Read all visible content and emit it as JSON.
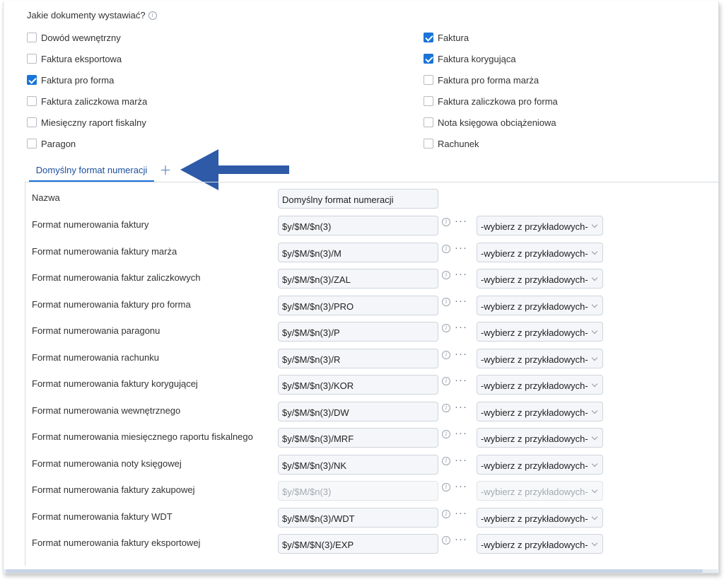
{
  "question": "Jakie dokumenty wystawiać?",
  "document_types": [
    {
      "label": "Dowód wewnętrzny",
      "checked": false
    },
    {
      "label": "Faktura",
      "checked": true
    },
    {
      "label": "Faktura eksportowa",
      "checked": false
    },
    {
      "label": "Faktura korygująca",
      "checked": true
    },
    {
      "label": "Faktura pro forma",
      "checked": true
    },
    {
      "label": "Faktura pro forma marża",
      "checked": false
    },
    {
      "label": "Faktura zaliczkowa marża",
      "checked": false
    },
    {
      "label": "Faktura zaliczkowa pro forma",
      "checked": false
    },
    {
      "label": "Miesięczny raport fiskalny",
      "checked": false
    },
    {
      "label": "Nota księgowa obciążeniowa",
      "checked": false
    },
    {
      "label": "Paragon",
      "checked": false
    },
    {
      "label": "Rachunek",
      "checked": false
    }
  ],
  "tabs": {
    "active_label": "Domyślny format numeracji",
    "add_label": "+"
  },
  "info_glyph": "i",
  "more_glyph": "···",
  "name_row": {
    "label": "Nazwa",
    "value": "Domyślny format numeracji"
  },
  "format_rows": [
    {
      "label": "Format numerowania faktury",
      "value": "$y/$M/$n(3)",
      "select": "-wybierz z przykładowych-",
      "disabled": false
    },
    {
      "label": "Format numerowania faktury marża",
      "value": "$y/$M/$n(3)/M",
      "select": "-wybierz z przykładowych-",
      "disabled": false
    },
    {
      "label": "Format numerowania faktur zaliczkowych",
      "value": "$y/$M/$n(3)/ZAL",
      "select": "-wybierz z przykładowych-",
      "disabled": false
    },
    {
      "label": "Format numerowania faktury pro forma",
      "value": "$y/$M/$n(3)/PRO",
      "select": "-wybierz z przykładowych-",
      "disabled": false
    },
    {
      "label": "Format numerowania paragonu",
      "value": "$y/$M/$n(3)/P",
      "select": "-wybierz z przykładowych-",
      "disabled": false
    },
    {
      "label": "Format numerowania rachunku",
      "value": "$y/$M/$n(3)/R",
      "select": "-wybierz z przykładowych-",
      "disabled": false
    },
    {
      "label": "Format numerowania faktury korygującej",
      "value": "$y/$M/$n(3)/KOR",
      "select": "-wybierz z przykładowych-",
      "disabled": false
    },
    {
      "label": "Format numerowania wewnętrznego",
      "value": "$y/$M/$n(3)/DW",
      "select": "-wybierz z przykładowych-",
      "disabled": false
    },
    {
      "label": "Format numerowania miesięcznego raportu fiskalnego",
      "value": "$y/$M/$n(3)/MRF",
      "select": "-wybierz z przykładowych-",
      "disabled": false
    },
    {
      "label": "Format numerowania noty księgowej",
      "value": "$y/$M/$n(3)/NK",
      "select": "-wybierz z przykładowych-",
      "disabled": false
    },
    {
      "label": "Format numerowania faktury zakupowej",
      "value": "$y/$M/$n(3)",
      "select": "-wybierz z przykładowych-",
      "disabled": true
    },
    {
      "label": "Format numerowania faktury WDT",
      "value": "$y/$M/$n(3)/WDT",
      "select": "-wybierz z przykładowych-",
      "disabled": false
    },
    {
      "label": "Format numerowania faktury eksportowej",
      "value": "$y/$M/$N(3)/EXP",
      "select": "-wybierz z przykładowych-",
      "disabled": false
    }
  ],
  "colors": {
    "accent": "#1a74d9",
    "arrow": "#2e5aa8",
    "tab_text": "#1a4e9a"
  },
  "icons": {
    "info": "info-icon",
    "more": "more-icon",
    "add": "plus-icon",
    "select_caret": "chevron-down-icon",
    "annotation": "arrow-left-icon"
  }
}
